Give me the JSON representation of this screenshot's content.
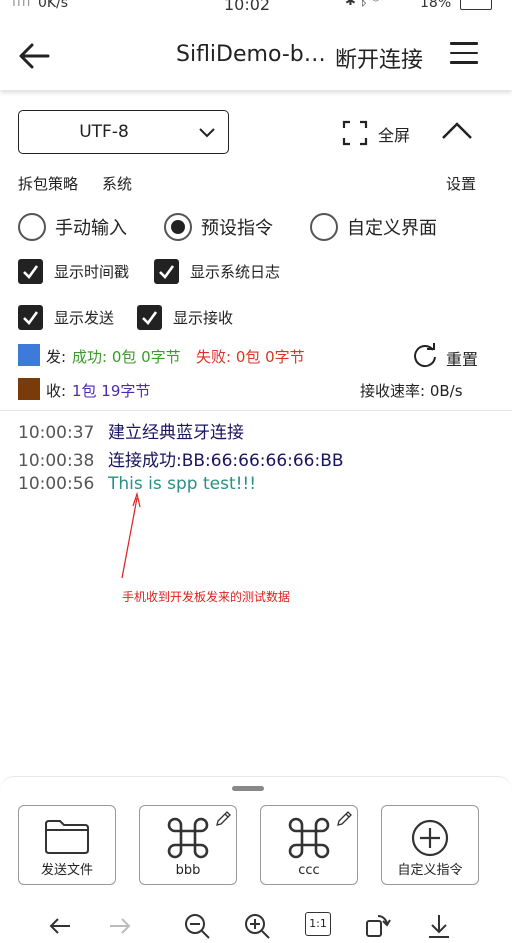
{
  "status_bar": {
    "signal": "ıııı",
    "network_speed": "0K/s",
    "time": "10:02",
    "icons": "✱ ᛒ ⌔",
    "battery": "18%"
  },
  "header": {
    "title": "SifliDemo-b…",
    "disconnect_label": "断开连接",
    "icons": [
      "back-arrow-icon",
      "hamburger-menu-icon"
    ]
  },
  "settings": {
    "encoding": "UTF-8",
    "fullscreen_label": "全屏",
    "split_strategy_label": "拆包策略",
    "split_strategy_value": "系统",
    "settings_label": "设置"
  },
  "input_mode": {
    "options": [
      {
        "label": "手动输入",
        "selected": false
      },
      {
        "label": "预设指令",
        "selected": true
      },
      {
        "label": "自定义界面",
        "selected": false
      }
    ]
  },
  "checkboxes": {
    "show_timestamp": {
      "label": "显示时间戳",
      "checked": true
    },
    "show_system_log": {
      "label": "显示系统日志",
      "checked": true
    },
    "show_send": {
      "label": "显示发送",
      "checked": true
    },
    "show_receive": {
      "label": "显示接收",
      "checked": true
    }
  },
  "stats": {
    "send_label": "发:",
    "send_success": "成功: 0包 0字节",
    "send_fail": "失败: 0包 0字节",
    "send_color": "#3d7ad9",
    "receive_label": "收:",
    "receive_value": "1包 19字节",
    "receive_color": "#7a3b0a",
    "reset_label": "重置",
    "rate": "接收速率: 0B/s"
  },
  "log": [
    {
      "time": "10:00:37",
      "message": "建立经典蓝牙连接"
    },
    {
      "time": "10:00:38",
      "message": "连接成功:BB:66:66:66:66:BB"
    },
    {
      "time": "10:00:56",
      "message": "This is spp test!!!"
    }
  ],
  "annotation": "手机收到开发板发来的测试数据",
  "tiles": [
    {
      "label": "发送文件",
      "icon": "folder-icon"
    },
    {
      "label": "bbb",
      "icon": "command-icon"
    },
    {
      "label": "ccc",
      "icon": "command-icon"
    },
    {
      "label": "自定义指令",
      "icon": "plus-circle-icon"
    }
  ],
  "bottom_toolbar": {
    "zoom_reset_label": "1:1"
  },
  "colors": {
    "success": "#3a9a2a",
    "fail": "#d9332b",
    "receive_text": "#4b2ab8",
    "log_received": "#2a8f84",
    "log_system": "#1a1560",
    "annotation": "#e02020"
  }
}
